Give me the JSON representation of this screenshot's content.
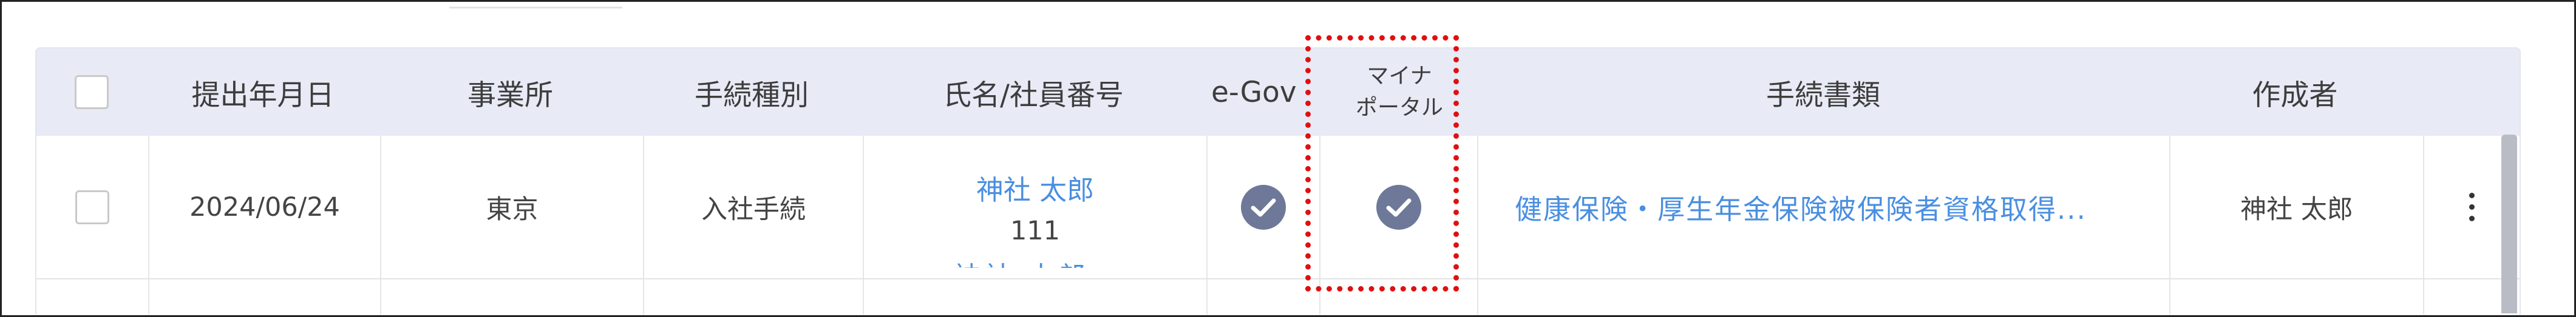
{
  "table": {
    "headers": {
      "date": "提出年月日",
      "office": "事業所",
      "procedure_type": "手続種別",
      "name_employee_no": "氏名/社員番号",
      "egov": "e-Gov",
      "mynaportal_line1": "マイナ",
      "mynaportal_line2": "ポータル",
      "documents": "手続書類",
      "creator": "作成者"
    },
    "rows": [
      {
        "date": "2024/06/24",
        "office": "東京",
        "procedure_type": "入社手続",
        "name": "神社 太郎",
        "employee_no": "111",
        "egov_status": "check-circle-icon",
        "mynaportal_status": "check-circle-icon",
        "document": "健康保険・厚生年金保険被保険者資格取得...",
        "creator": "神社 太郎"
      }
    ],
    "next_row_partial_name": "神社 太郎"
  },
  "colors": {
    "header_bg": "#e8eaf6",
    "link": "#4a8fe0",
    "status_icon": "#6e7898",
    "highlight": "#e01010"
  }
}
